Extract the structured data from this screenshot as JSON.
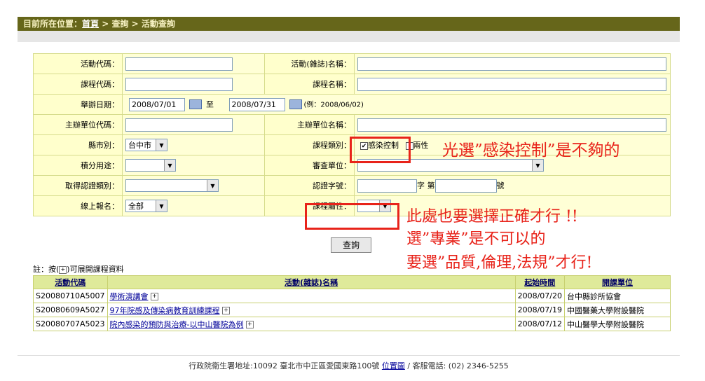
{
  "breadcrumb": {
    "prefix": "目前所在位置：",
    "home": "首頁",
    "rest": " > 查詢 > 活動查詢"
  },
  "form": {
    "activity_code_label": "活動代碼：",
    "activity_name_label": "活動(雜誌)名稱：",
    "course_code_label": "課程代碼：",
    "course_name_label": "課程名稱：",
    "date_label": "舉辦日期：",
    "date_from": "2008/07/01",
    "date_to_sep": "至",
    "date_to": "2008/07/31",
    "date_example": "(例：2008/06/02)",
    "organizer_code_label": "主辦單位代碼：",
    "organizer_name_label": "主辦單位名稱：",
    "city_label": "縣市別：",
    "city_value": "台中市",
    "course_type_label": "課程類別：",
    "course_type_opt1": "感染控制",
    "course_type_opt2": "兩性",
    "credit_use_label": "積分用途：",
    "review_unit_label": "審查單位：",
    "cert_type_label": "取得認證類別：",
    "cert_no_label": "認證字號：",
    "cert_no_mid": "字 第",
    "cert_no_end": "號",
    "online_label": "線上報名：",
    "online_value": "全部",
    "course_attr_label": "課程屬性："
  },
  "annotations": {
    "note1": "光選”感染控制”是不夠的",
    "note2_line1": "此處也要選擇正確才行 !!",
    "note2_line2": "選”專業”是不可以的",
    "note2_line3": "要選”品質,倫理,法規”才行!"
  },
  "query_button": "查詢",
  "hint": {
    "prefix": "註：按(",
    "plus": "+",
    "suffix": ")可展開課程資料"
  },
  "results": {
    "headers": [
      "活動代碼",
      "活動(雜誌)名稱",
      "起始時間",
      "開課單位"
    ],
    "rows": [
      {
        "code": "S20080710A5007",
        "name": "學術演講會",
        "date": "2008/07/20",
        "unit": "台中縣診所協會"
      },
      {
        "code": "S20080609A5027",
        "name": "97年院感及傳染病教育訓練課程",
        "date": "2008/07/19",
        "unit": "中國醫藥大學附設醫院"
      },
      {
        "code": "S20080707A5023",
        "name": "院內感染的預防與治療-以中山醫院為例",
        "date": "2008/07/12",
        "unit": "中山醫學大學附設醫院"
      }
    ]
  },
  "footer": {
    "text": "行政院衛生署地址:10092 臺北市中正區愛國東路100號 ",
    "map_link": "位置圖",
    "phone": " / 客服電話: (02) 2346-5255"
  }
}
